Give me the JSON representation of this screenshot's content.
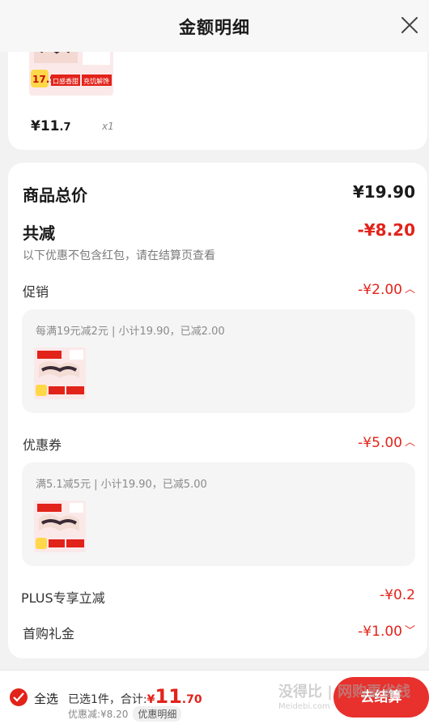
{
  "header": {
    "title": "金额明细"
  },
  "top_item": {
    "price_main": "¥11",
    "price_cents": ".7",
    "qty": "x1"
  },
  "summary": {
    "total_label": "商品总价",
    "total_value": "¥19.90",
    "discount_label": "共减",
    "discount_value": "-¥8.20",
    "discount_note": "以下优惠不包含红包，请在结算页查看"
  },
  "promo": {
    "label": "促销",
    "value": "-¥2.00",
    "detail": "每满19元减2元 | 小计19.90，已减2.00"
  },
  "coupon": {
    "label": "优惠券",
    "value": "-¥5.00",
    "detail": "满5.1减5元 | 小计19.90，已减5.00"
  },
  "plus": {
    "label": "PLUS专享立减",
    "value": "-¥0.2"
  },
  "firstbuy": {
    "label": "首购礼金",
    "value": "-¥1.00"
  },
  "bottom": {
    "select_all": "全选",
    "selected_text": "已选1件，合计:",
    "yen": "¥",
    "amount_main": "11",
    "amount_cents": ".70",
    "discounted_text": "优惠减:¥8.20",
    "detail_button": "优惠明细",
    "checkout": "去结算"
  },
  "watermark": {
    "text": "没得比 | 网购更省钱",
    "sub": "Meidebi.com"
  },
  "product_badge": {
    "price": "17.9",
    "tag1": "口感香甜",
    "tag2": "充饥解馋"
  },
  "colors": {
    "accent": "#e2231a",
    "checkout_bg": "#e8302c"
  }
}
